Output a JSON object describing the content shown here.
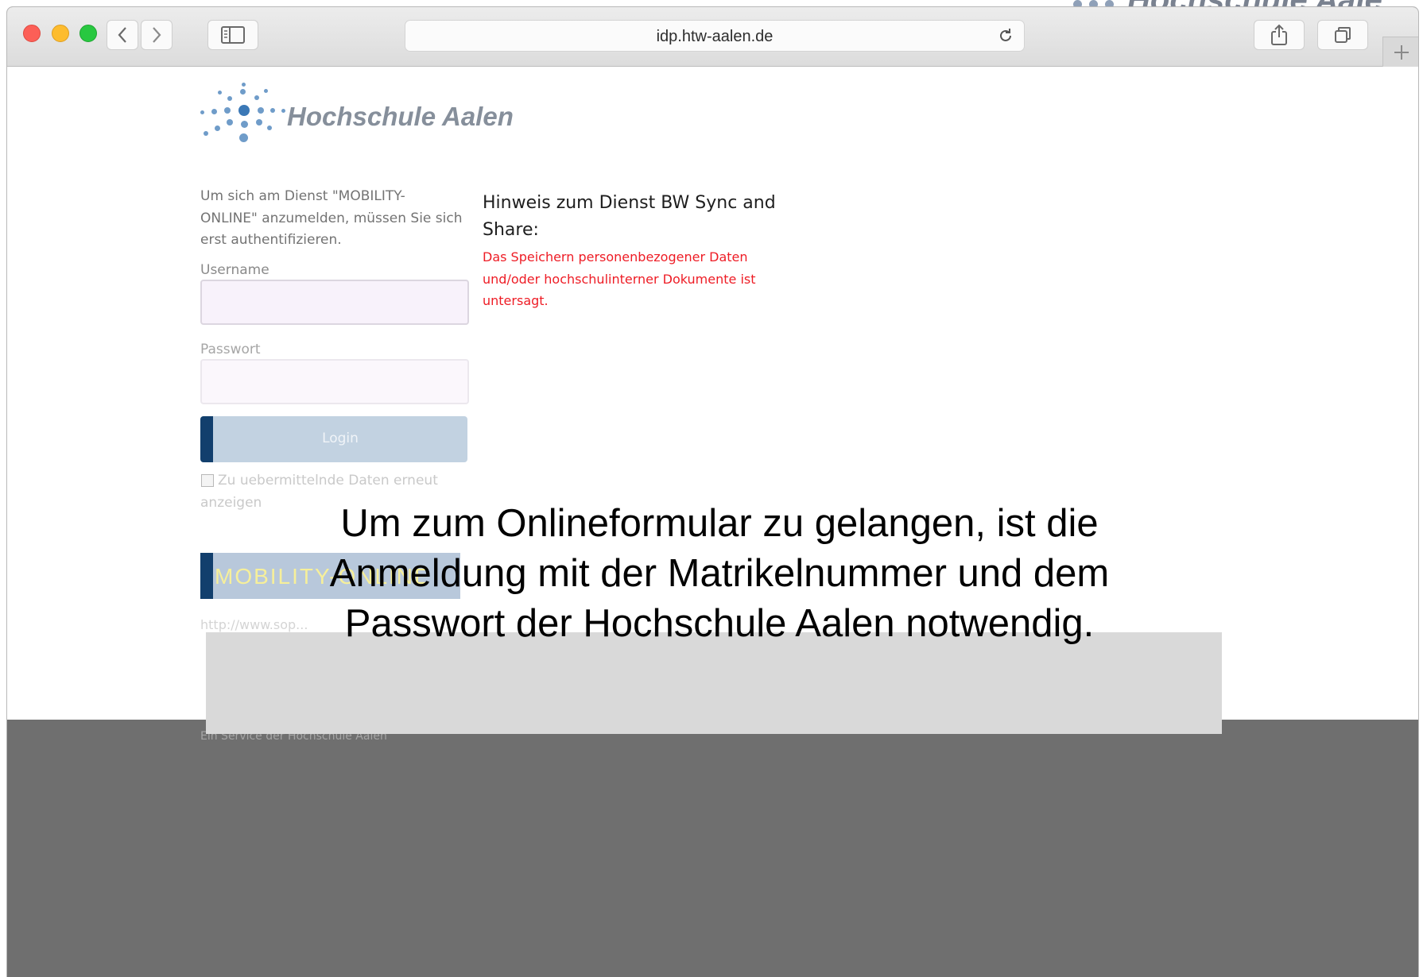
{
  "browser": {
    "url": "idp.htw-aalen.de"
  },
  "header": {
    "logo_text": "Hochschule Aalen",
    "background_logo_text": "Hochschule Aale"
  },
  "login_form": {
    "intro": "Um sich am Dienst \"MOBILITY-ONLINE\" anzumelden, müssen Sie sich erst authentifizieren.",
    "username_label": "Username",
    "username_value": "",
    "password_label": "Passwort",
    "password_value": "",
    "login_button": "Login",
    "checkbox_label": "Zu uebermittelnde Daten erneut anzeigen",
    "service_logo_text": "MOBILITY-ONLINE",
    "service_link": "http://www.sop..."
  },
  "notice": {
    "title": "Hinweis zum Dienst BW Sync and Share:",
    "body": "Das Speichern personenbezogener Daten und/oder hochschulinterner Dokumente ist untersagt."
  },
  "footer": {
    "text": "Ein Service der Hochschule Aalen"
  },
  "overlay": {
    "caption": "Um zum Onlineformular zu gelangen, ist die Anmeldung mit der Matrikelnummer und dem Passwort der Hochschule Aalen notwendig."
  },
  "colors": {
    "accent_blue": "#123f6d",
    "notice_red": "#ee1c25",
    "footer_gray": "#6f6f6f"
  }
}
